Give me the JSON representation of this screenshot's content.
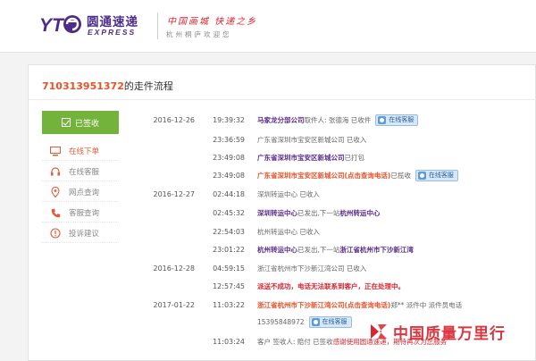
{
  "header": {
    "logo_mark": "YT",
    "logo_cn": "圆通速递",
    "logo_en": "EXPRESS",
    "slogan": "中国画城  快递之乡",
    "welcome": "杭州桐庐欢迎您"
  },
  "page": {
    "tracking_no": "710313951372",
    "title_suffix": "的走件流程"
  },
  "sidebar": {
    "active_label": "已签收",
    "items": [
      {
        "label": "在线下单",
        "icon": "monitor-icon"
      },
      {
        "label": "在线客服",
        "icon": "headset-icon"
      },
      {
        "label": "网点查询",
        "icon": "location-pin-icon"
      },
      {
        "label": "客服查询",
        "icon": "phone-icon"
      },
      {
        "label": "投诉建议",
        "icon": "complaint-icon"
      }
    ]
  },
  "service_button_label": "在线客服",
  "events": [
    {
      "date": "2016-12-26",
      "time": "19:39:32",
      "seg1": "马家龙分部公司",
      "seg2": " 取件人: 张德海 已收件",
      "btn": true
    },
    {
      "date": "",
      "time": "23:36:59",
      "seg1": "",
      "seg2": "广东省深圳市宝安区新城公司 已收入"
    },
    {
      "date": "",
      "time": "23:49:08",
      "seg1": "广东省深圳市宝安区新城公司",
      "seg2": " 已打包"
    },
    {
      "date": "",
      "time": "23:49:08",
      "seg1": "广东省深圳市宝安区新城公司(点击查询电话)",
      "seg2": " 已揽收",
      "btn": true
    },
    {
      "date": "2016-12-27",
      "time": "02:44:18",
      "seg1": "",
      "seg2": "深圳转运中心 已收入"
    },
    {
      "date": "",
      "time": "02:45:32",
      "seg1": "深圳转运中心",
      "seg2": " 已发出,下一站 ",
      "seg3": "杭州转运中心"
    },
    {
      "date": "",
      "time": "22:54:03",
      "seg1": "",
      "seg2": "杭州转运中心 已收入"
    },
    {
      "date": "",
      "time": "23:01:22",
      "seg1": "杭州转运中心",
      "seg2": " 已发出,下一站 ",
      "seg3": "浙江省杭州市下沙新江湾"
    },
    {
      "date": "2016-12-28",
      "time": "04:59:15",
      "seg1": "",
      "seg2": "浙江省杭州市下沙新江湾公司 已收入"
    },
    {
      "date": "",
      "time": "12:57:45",
      "seg1": "派送不成功，电话无法联系到客户，正在处理中。",
      "seg2": ""
    },
    {
      "date": "2017-01-22",
      "time": "11:03:22",
      "seg1": "浙江省杭州市下沙新江湾公司(点击查询电话)",
      "seg2": "郑** 派件中 派件员电话"
    },
    {
      "date": "",
      "time": "",
      "seg1": "",
      "seg2": "15395848972",
      "btn": true
    },
    {
      "date": "",
      "time": "11:03:24",
      "seg1": "",
      "seg2": "客户 签收人: 赔付 已签收 ",
      "seg3": "感谢使用圆通速递，期待再次为您服务"
    }
  ],
  "watermark": "中国质量万里行",
  "colors": {
    "brand_purple": "#4d2c8a",
    "accent_orange": "#e8522a",
    "signed_green": "#74b33b",
    "alert_red": "#d8262f"
  }
}
